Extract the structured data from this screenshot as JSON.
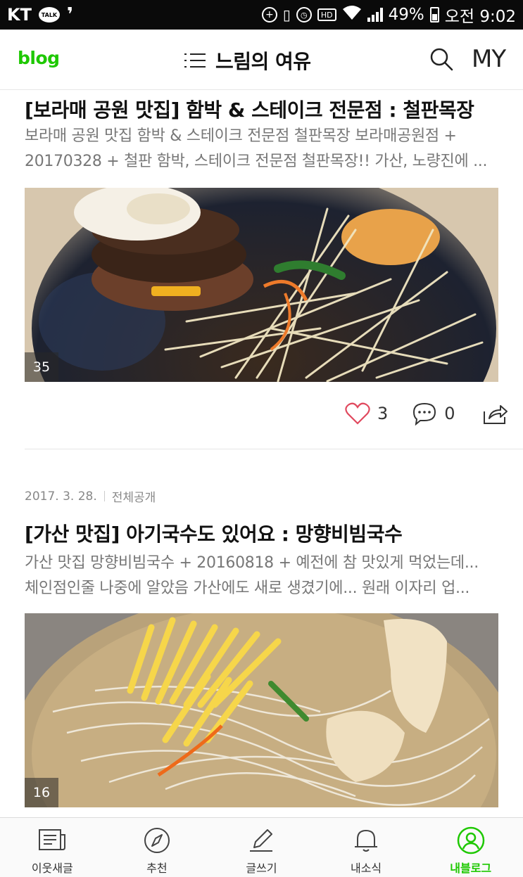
{
  "status_bar": {
    "carrier": "KT",
    "talk_badge": "TALK",
    "battery_percent": "49%",
    "time": "오전 9:02",
    "hd_label": "HD"
  },
  "header": {
    "logo": "blog",
    "title": "느림의 여유",
    "my_label": "MY"
  },
  "posts": [
    {
      "title": "[보라매 공원 맛집] 함박 & 스테이크 전문점 : 철판목장",
      "excerpt_line1": "보라매 공원 맛집 함박 & 스테이크 전문점 철판목장 보라매공원점 +",
      "excerpt_line2": "20170328 + 철판 함박, 스테이크 전문점 철판목장!! 가산, 노량진에 ...",
      "photo_count": "35",
      "likes": "3",
      "comments": "0"
    },
    {
      "date": "2017. 3. 28.",
      "visibility": "전체공개",
      "title": "[가산 맛집] 아기국수도 있어요 : 망향비빔국수",
      "excerpt_line1": "가산 맛집 망향비빔국수 + 20160818 + 예전에 참 맛있게 먹었는데...",
      "excerpt_line2": "체인점인줄 나중에 알았음 가산에도 새로 생겼기에... 원래 이자리 업...",
      "photo_count": "16"
    }
  ],
  "bottom_nav": {
    "items": [
      {
        "label": "이웃새글"
      },
      {
        "label": "추천"
      },
      {
        "label": "글쓰기"
      },
      {
        "label": "내소식"
      },
      {
        "label": "내블로그"
      }
    ],
    "active_color": "#1ec800"
  },
  "colors": {
    "brand": "#1ec800",
    "like_heart": "#e0495e"
  }
}
